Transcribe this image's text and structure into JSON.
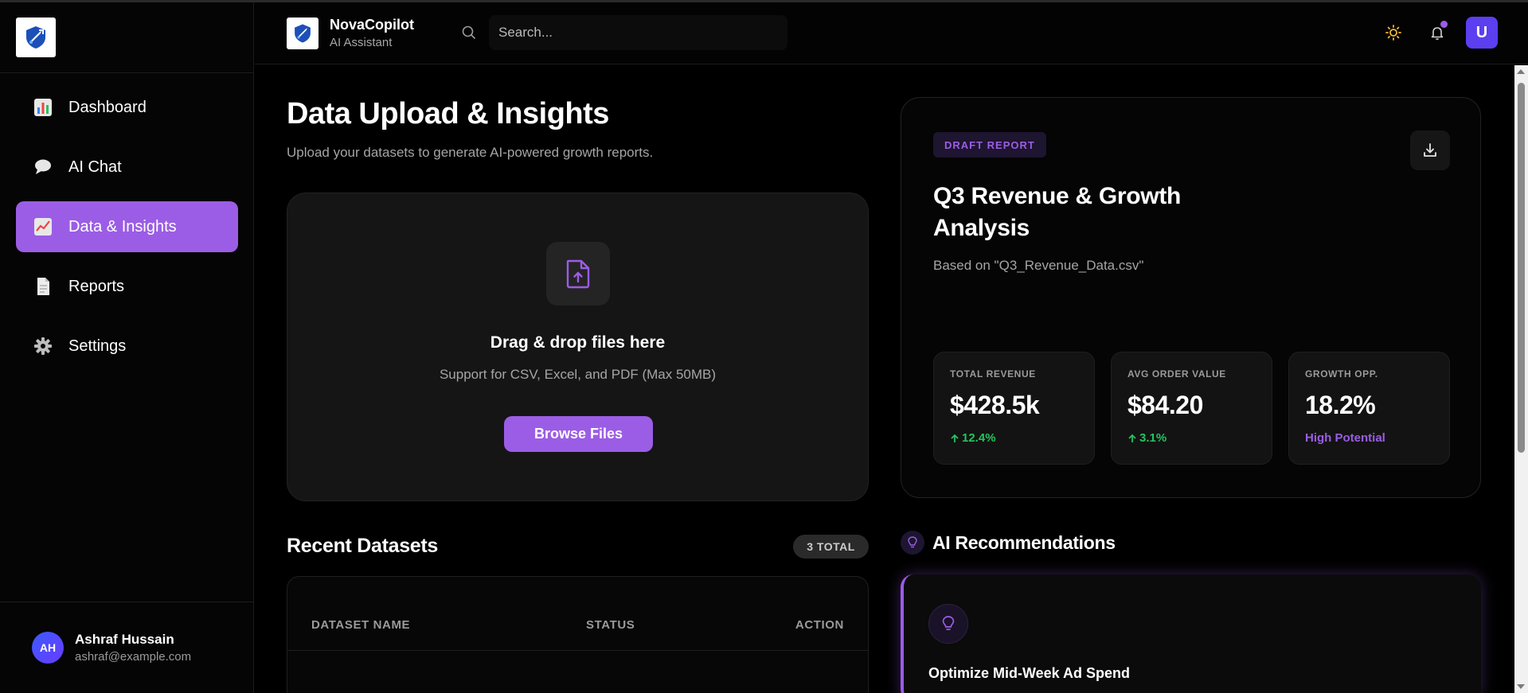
{
  "app": {
    "name": "NovaCopilot",
    "subtitle": "AI Assistant"
  },
  "search": {
    "placeholder": "Search..."
  },
  "header": {
    "avatar_initial": "U",
    "icons": [
      "sun-icon",
      "bell-icon"
    ]
  },
  "sidebar": {
    "items": [
      {
        "label": "Dashboard",
        "icon": "bar-chart-icon",
        "active": false
      },
      {
        "label": "AI Chat",
        "icon": "speech-bubble-icon",
        "active": false
      },
      {
        "label": "Data & Insights",
        "icon": "line-chart-icon",
        "active": true
      },
      {
        "label": "Reports",
        "icon": "document-icon",
        "active": false
      },
      {
        "label": "Settings",
        "icon": "gear-icon",
        "active": false
      }
    ],
    "user": {
      "initials": "AH",
      "name": "Ashraf Hussain",
      "email": "ashraf@example.com"
    }
  },
  "main": {
    "title": "Data Upload & Insights",
    "subtitle": "Upload your datasets to generate AI-powered growth reports.",
    "upload": {
      "title": "Drag & drop files here",
      "subtitle": "Support for CSV, Excel, and PDF (Max 50MB)",
      "button": "Browse Files"
    },
    "recent": {
      "title": "Recent Datasets",
      "badge": "3 TOTAL",
      "columns": [
        "DATASET NAME",
        "STATUS",
        "ACTION"
      ]
    }
  },
  "report": {
    "badge": "DRAFT REPORT",
    "title": "Q3 Revenue & Growth Analysis",
    "subtitle": "Based on \"Q3_Revenue_Data.csv\"",
    "kpis": [
      {
        "label": "TOTAL REVENUE",
        "value": "$428.5k",
        "delta": "12.4%",
        "delta_style": "up"
      },
      {
        "label": "AVG ORDER VALUE",
        "value": "$84.20",
        "delta": "3.1%",
        "delta_style": "up"
      },
      {
        "label": "GROWTH OPP.",
        "value": "18.2%",
        "delta": "High Potential",
        "delta_style": "note"
      }
    ]
  },
  "recommendations": {
    "title": "AI Recommendations",
    "items": [
      {
        "title": "Optimize Mid-Week Ad Spend",
        "icon": "lightbulb-icon"
      }
    ]
  },
  "colors": {
    "accent": "#9b5de5",
    "positive": "#22c55e",
    "background": "#000000",
    "card": "#151515"
  }
}
